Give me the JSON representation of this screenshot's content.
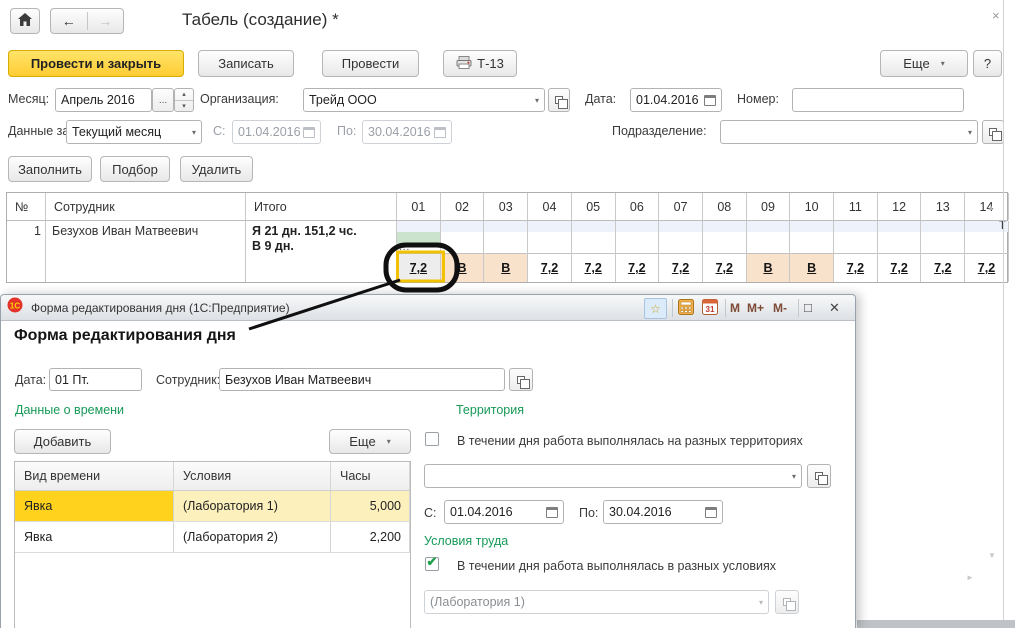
{
  "window": {
    "title": "Табель (создание) *"
  },
  "icons": {
    "close": "×",
    "dropdown": "▾",
    "spin_up": "▴",
    "spin_down": "▾",
    "ellipsis": "...",
    "back": "←",
    "forward": "→",
    "star": "☆",
    "maximize": "□",
    "dialog_close": "✕",
    "check": "✔",
    "scroll_up": "▲",
    "scroll_down": "▼",
    "scroll_right": "►"
  },
  "toolbar": {
    "post_and_close": "Провести и закрыть",
    "write": "Записать",
    "post": "Провести",
    "t13": "Т-13",
    "more": "Еще",
    "help": "?"
  },
  "fields": {
    "month_label": "Месяц:",
    "month_value": "Апрель 2016",
    "org_label": "Организация:",
    "org_value": "Трейд ООО",
    "date_label": "Дата:",
    "date_value": "01.04.2016",
    "number_label": "Номер:",
    "number_value": ""
  },
  "filter": {
    "data_for_label": "Данные за:",
    "data_for_value": "Текущий месяц",
    "from_label": "С:",
    "from_value": "01.04.2016",
    "to_label": "По:",
    "to_value": "30.04.2016",
    "department_label": "Подразделение:",
    "department_value": ""
  },
  "actions": {
    "fill": "Заполнить",
    "pick": "Подбор",
    "delete": "Удалить"
  },
  "grid": {
    "headers": {
      "num": "№",
      "employee": "Сотрудник",
      "total": "Итого"
    },
    "days": [
      "01",
      "02",
      "03",
      "04",
      "05",
      "06",
      "07",
      "08",
      "09",
      "10",
      "11",
      "12",
      "13",
      "14"
    ],
    "row": {
      "num": "1",
      "employee": "Безухов Иван Матвеевич",
      "total_line1": "Я 21 дн. 151,2 чс.",
      "total_line2": "В 9 дн.",
      "day14_top": "Т",
      "more_marker": "...",
      "values": [
        "7,2",
        "В",
        "В",
        "7,2",
        "7,2",
        "7,2",
        "7,2",
        "7,2",
        "В",
        "В",
        "7,2",
        "7,2",
        "7,2",
        "7,2"
      ]
    }
  },
  "dialog": {
    "titlebar": {
      "title": "Форма редактирования дня  (1С:Предприятие)",
      "m": "M",
      "m_plus": "M+",
      "m_minus": "M-"
    },
    "heading": "Форма редактирования дня",
    "date_label": "Дата:",
    "date_value": "01 Пт.",
    "employee_label": "Сотрудник:",
    "employee_value": "Безухов Иван Матвеевич",
    "time": {
      "section": "Данные о времени",
      "add": "Добавить",
      "more": "Еще",
      "col_type": "Вид времени",
      "col_cond": "Условия",
      "col_hours": "Часы",
      "rows": [
        {
          "type": "Явка",
          "cond": "(Лаборатория 1)",
          "hours": "5,000"
        },
        {
          "type": "Явка",
          "cond": "(Лаборатория 2)",
          "hours": "2,200"
        }
      ]
    },
    "territory": {
      "section": "Территория",
      "checkbox": "В течении дня работа выполнялась на разных территориях",
      "value": "",
      "from_label": "С:",
      "from_value": "01.04.2016",
      "to_label": "По:",
      "to_value": "30.04.2016"
    },
    "conditions": {
      "section": "Условия труда",
      "checkbox": "В течении дня работа выполнялась в разных условиях",
      "value": "(Лаборатория 1)"
    }
  },
  "colors": {
    "accent_yellow": "#ffd21e",
    "section_green": "#169a58",
    "weekend_bg": "#f9e2cb",
    "selected_day_bg": "#cbe3cc",
    "selected_row_bg": "#fcf0bd"
  }
}
